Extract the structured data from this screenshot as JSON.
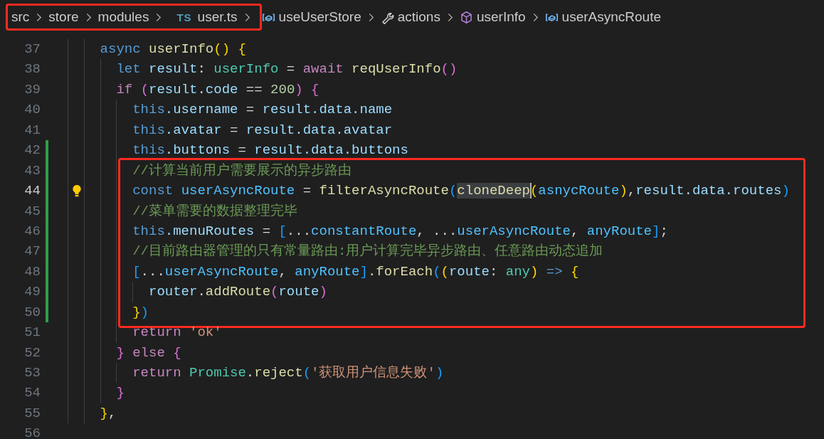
{
  "breadcrumb": [
    {
      "highlighted": true,
      "items": [
        {
          "label": "src",
          "kind": "folder"
        },
        {
          "label": "store",
          "kind": "folder"
        },
        {
          "label": "modules",
          "kind": "folder"
        },
        {
          "label": "user.ts",
          "kind": "file",
          "badge": "TS"
        }
      ]
    },
    {
      "highlighted": false,
      "items": [
        {
          "label": "useUserStore",
          "kind": "variable"
        },
        {
          "label": "actions",
          "kind": "property"
        },
        {
          "label": "userInfo",
          "kind": "method"
        },
        {
          "label": "userAsyncRoute",
          "kind": "variable"
        }
      ]
    }
  ],
  "code_blocks": [
    {
      "highlighted": false,
      "lines": [
        {
          "number": "37",
          "current": false,
          "changed": false,
          "code_action": false,
          "tokens": [
            {
              "text": "    async ",
              "kind": "kw"
            },
            {
              "text": "userInfo",
              "kind": "fn"
            },
            {
              "text": "() {",
              "kind": "b1"
            }
          ]
        },
        {
          "number": "38",
          "current": false,
          "changed": false,
          "code_action": false,
          "tokens": [
            {
              "text": "      let ",
              "kind": "kw"
            },
            {
              "text": "result",
              "kind": "var"
            },
            {
              "text": ": ",
              "kind": "p"
            },
            {
              "text": "userInfo",
              "kind": "type"
            },
            {
              "text": " = ",
              "kind": "p"
            },
            {
              "text": "await ",
              "kind": "ctl"
            },
            {
              "text": "reqUserInfo",
              "kind": "fn"
            },
            {
              "text": "()",
              "kind": "b2"
            }
          ]
        },
        {
          "number": "39",
          "current": false,
          "changed": false,
          "code_action": false,
          "tokens": [
            {
              "text": "      if ",
              "kind": "ctl"
            },
            {
              "text": "(",
              "kind": "b2"
            },
            {
              "text": "result",
              "kind": "var"
            },
            {
              "text": ".",
              "kind": "p"
            },
            {
              "text": "code",
              "kind": "var"
            },
            {
              "text": " == ",
              "kind": "p"
            },
            {
              "text": "200",
              "kind": "num"
            },
            {
              "text": ") {",
              "kind": "b2"
            }
          ]
        },
        {
          "number": "40",
          "current": false,
          "changed": false,
          "code_action": false,
          "tokens": [
            {
              "text": "        this",
              "kind": "kw"
            },
            {
              "text": ".username",
              "kind": "var"
            },
            {
              "text": " = ",
              "kind": "p"
            },
            {
              "text": "result.data.name",
              "kind": "var"
            }
          ]
        },
        {
          "number": "41",
          "current": false,
          "changed": false,
          "code_action": false,
          "tokens": [
            {
              "text": "        this",
              "kind": "kw"
            },
            {
              "text": ".avatar",
              "kind": "var"
            },
            {
              "text": " = ",
              "kind": "p"
            },
            {
              "text": "result.data.avatar",
              "kind": "var"
            }
          ]
        },
        {
          "number": "42",
          "current": false,
          "changed": true,
          "code_action": false,
          "tokens": [
            {
              "text": "        this",
              "kind": "kw"
            },
            {
              "text": ".buttons",
              "kind": "var"
            },
            {
              "text": " = ",
              "kind": "p"
            },
            {
              "text": "result.data.buttons",
              "kind": "var"
            }
          ]
        }
      ]
    },
    {
      "highlighted": true,
      "lines": [
        {
          "number": "43",
          "current": false,
          "changed": true,
          "code_action": false,
          "tokens": [
            {
              "text": "        //计算当前用户需要展示的异步路由",
              "kind": "com"
            }
          ]
        },
        {
          "number": "44",
          "current": true,
          "changed": true,
          "code_action": true,
          "tokens": [
            {
              "text": "        const ",
              "kind": "kw"
            },
            {
              "text": "userAsyncRoute",
              "kind": "const"
            },
            {
              "text": " = ",
              "kind": "p"
            },
            {
              "text": "filterAsyncRoute",
              "kind": "fn"
            },
            {
              "text": "(",
              "kind": "b3"
            },
            {
              "text": "cloneDeep",
              "kind": "fn",
              "selected": true
            },
            {
              "text": "(",
              "kind": "b1"
            },
            {
              "text": "asnycRoute",
              "kind": "const"
            },
            {
              "text": ")",
              "kind": "b1"
            },
            {
              "text": ",",
              "kind": "p"
            },
            {
              "text": "result.data.routes",
              "kind": "var"
            },
            {
              "text": ")",
              "kind": "b3"
            }
          ]
        },
        {
          "number": "45",
          "current": false,
          "changed": true,
          "code_action": false,
          "tokens": [
            {
              "text": "        //菜单需要的数据整理完毕",
              "kind": "com"
            }
          ]
        },
        {
          "number": "46",
          "current": false,
          "changed": true,
          "code_action": false,
          "tokens": [
            {
              "text": "        this",
              "kind": "kw"
            },
            {
              "text": ".menuRoutes",
              "kind": "var"
            },
            {
              "text": " = ",
              "kind": "p"
            },
            {
              "text": "[",
              "kind": "b3"
            },
            {
              "text": "...",
              "kind": "p"
            },
            {
              "text": "constantRoute",
              "kind": "const"
            },
            {
              "text": ", ...",
              "kind": "p"
            },
            {
              "text": "userAsyncRoute",
              "kind": "const"
            },
            {
              "text": ", ",
              "kind": "p"
            },
            {
              "text": "anyRoute",
              "kind": "const"
            },
            {
              "text": "]",
              "kind": "b3"
            },
            {
              "text": ";",
              "kind": "p"
            }
          ]
        },
        {
          "number": "47",
          "current": false,
          "changed": true,
          "code_action": false,
          "tokens": [
            {
              "text": "        //目前路由器管理的只有常量路由:用户计算完毕异步路由、任意路由动态追加",
              "kind": "com"
            }
          ]
        },
        {
          "number": "48",
          "current": false,
          "changed": true,
          "code_action": false,
          "tokens": [
            {
              "text": "        [",
              "kind": "b3"
            },
            {
              "text": "...",
              "kind": "p"
            },
            {
              "text": "userAsyncRoute",
              "kind": "const"
            },
            {
              "text": ", ",
              "kind": "p"
            },
            {
              "text": "anyRoute",
              "kind": "const"
            },
            {
              "text": "]",
              "kind": "b3"
            },
            {
              "text": ".",
              "kind": "p"
            },
            {
              "text": "forEach",
              "kind": "fn"
            },
            {
              "text": "(",
              "kind": "b3"
            },
            {
              "text": "(",
              "kind": "b1"
            },
            {
              "text": "route",
              "kind": "var"
            },
            {
              "text": ": ",
              "kind": "p"
            },
            {
              "text": "any",
              "kind": "type"
            },
            {
              "text": ") ",
              "kind": "b1"
            },
            {
              "text": "=> ",
              "kind": "kw"
            },
            {
              "text": "{",
              "kind": "b1"
            }
          ]
        },
        {
          "number": "49",
          "current": false,
          "changed": true,
          "code_action": false,
          "tokens": [
            {
              "text": "          router",
              "kind": "var"
            },
            {
              "text": ".",
              "kind": "p"
            },
            {
              "text": "addRoute",
              "kind": "fn"
            },
            {
              "text": "(",
              "kind": "b2"
            },
            {
              "text": "route",
              "kind": "var"
            },
            {
              "text": ")",
              "kind": "b2"
            }
          ]
        },
        {
          "number": "50",
          "current": false,
          "changed": true,
          "code_action": false,
          "tokens": [
            {
              "text": "        }",
              "kind": "b1"
            },
            {
              "text": ")",
              "kind": "b3"
            }
          ]
        }
      ]
    },
    {
      "highlighted": false,
      "lines": [
        {
          "number": "51",
          "current": false,
          "changed": false,
          "code_action": false,
          "tokens": [
            {
              "text": "        return ",
              "kind": "ctl"
            },
            {
              "text": "'ok'",
              "kind": "str"
            }
          ]
        },
        {
          "number": "52",
          "current": false,
          "changed": false,
          "code_action": false,
          "tokens": [
            {
              "text": "      } ",
              "kind": "b2"
            },
            {
              "text": "else ",
              "kind": "ctl"
            },
            {
              "text": "{",
              "kind": "b2"
            }
          ]
        },
        {
          "number": "53",
          "current": false,
          "changed": false,
          "code_action": false,
          "tokens": [
            {
              "text": "        return ",
              "kind": "ctl"
            },
            {
              "text": "Promise",
              "kind": "type"
            },
            {
              "text": ".",
              "kind": "p"
            },
            {
              "text": "reject",
              "kind": "fn"
            },
            {
              "text": "(",
              "kind": "b3"
            },
            {
              "text": "'获取用户信息失败'",
              "kind": "str"
            },
            {
              "text": ")",
              "kind": "b3"
            }
          ]
        },
        {
          "number": "54",
          "current": false,
          "changed": false,
          "code_action": false,
          "tokens": [
            {
              "text": "      }",
              "kind": "b2"
            }
          ]
        },
        {
          "number": "55",
          "current": false,
          "changed": false,
          "code_action": false,
          "tokens": [
            {
              "text": "    }",
              "kind": "b1"
            },
            {
              "text": ",",
              "kind": "p"
            }
          ]
        },
        {
          "number": "56",
          "current": false,
          "changed": false,
          "code_action": false
        }
      ]
    }
  ]
}
